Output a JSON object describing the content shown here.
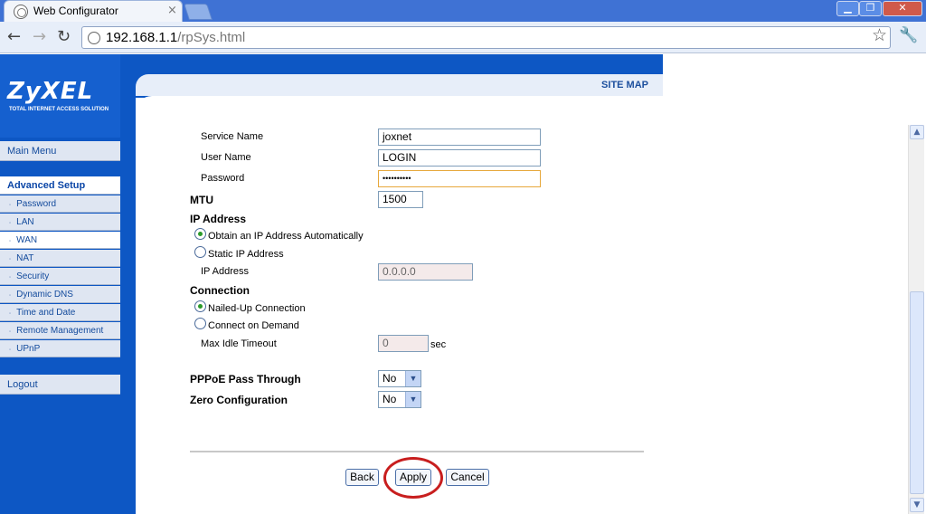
{
  "browser": {
    "tab_title": "Web Configurator",
    "tab_close": "×",
    "url_host": "192.168.1.1",
    "url_path": "/rpSys.html"
  },
  "brand": {
    "logo_text": "ZyXEL",
    "logo_tagline": "TOTAL INTERNET ACCESS SOLUTION",
    "sitemap": "SITE MAP"
  },
  "sidebar": {
    "main_menu": "Main Menu",
    "section": "Advanced Setup",
    "items": [
      "Password",
      "LAN",
      "WAN",
      "NAT",
      "Security",
      "Dynamic DNS",
      "Time and Date",
      "Remote Management",
      "UPnP"
    ],
    "selected": "WAN",
    "logout": "Logout"
  },
  "form": {
    "service_name_label": "Service Name",
    "service_name_value": "joxnet",
    "user_name_label": "User Name",
    "user_name_value": "LOGIN",
    "password_label": "Password",
    "password_value": "••••••••••",
    "mtu_label": "MTU",
    "mtu_value": "1500",
    "ip_address_heading": "IP Address",
    "obtain_auto_label": "Obtain an IP Address Automatically",
    "static_ip_label": "Static IP Address",
    "ip_address_label": "IP Address",
    "ip_address_value": "0.0.0.0",
    "connection_heading": "Connection",
    "nailed_up_label": "Nailed-Up Connection",
    "connect_demand_label": "Connect on Demand",
    "max_idle_label": "Max Idle Timeout",
    "max_idle_value": "0",
    "max_idle_unit": "sec",
    "pppoe_label": "PPPoE Pass Through",
    "pppoe_value": "No",
    "zero_config_label": "Zero Configuration",
    "zero_config_value": "No"
  },
  "buttons": {
    "back": "Back",
    "apply": "Apply",
    "cancel": "Cancel"
  }
}
